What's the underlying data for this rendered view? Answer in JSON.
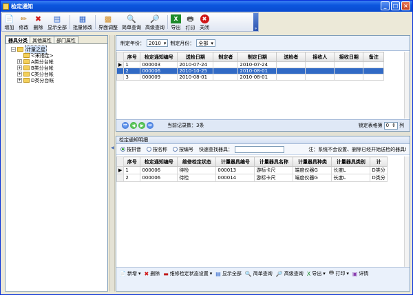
{
  "window": {
    "title": "检定通知"
  },
  "toolbar": [
    {
      "id": "add",
      "label": "增加",
      "icon": "📄"
    },
    {
      "id": "edit",
      "label": "修改",
      "icon": "✏"
    },
    {
      "id": "delete",
      "label": "删除",
      "icon": "✖"
    },
    {
      "id": "showall",
      "label": "显示全部",
      "icon": "▤"
    },
    {
      "id": "batchedit",
      "label": "批量修改",
      "icon": "▦"
    },
    {
      "id": "layout",
      "label": "界面调整",
      "icon": "▩"
    },
    {
      "id": "simplequery",
      "label": "简单查询",
      "icon": "🔍"
    },
    {
      "id": "advquery",
      "label": "高级查询",
      "icon": "🔎"
    },
    {
      "id": "export",
      "label": "导出",
      "icon": "X"
    },
    {
      "id": "print",
      "label": "打印",
      "icon": "🖶"
    },
    {
      "id": "close",
      "label": "关闭",
      "icon": "✖"
    }
  ],
  "left": {
    "tabs": [
      "器具分类",
      "其他属性",
      "部门属性"
    ],
    "tree": {
      "root": "计量之星",
      "children": [
        "<未指定>",
        "A类分台帐",
        "B类分台帐",
        "C类分台帐",
        "D类分台帐"
      ]
    }
  },
  "filter": {
    "year_label": "制定年份：",
    "year": "2010",
    "month_label": "制定月份：",
    "month": "全部"
  },
  "upper_table": {
    "columns": [
      "序号",
      "检定通知编号",
      "送检日期",
      "制定者",
      "制定日期",
      "送检者",
      "接收人",
      "接收日期",
      "备注"
    ],
    "rows": [
      [
        "1",
        "000003",
        "2010-07-24",
        "",
        "2010-07-24",
        "",
        "",
        "",
        ""
      ],
      [
        "2",
        "000006",
        "2010-10-25",
        "",
        "2010-08-01",
        "",
        "",
        "",
        ""
      ],
      [
        "3",
        "000009",
        "2010-08-01",
        "",
        "2010-08-01",
        "",
        "",
        "",
        ""
      ]
    ],
    "selected_index": 1
  },
  "nav": {
    "record_count": "当前记录数：3条",
    "lock_label": "锁定表格第",
    "lock_value": "0",
    "lock_suffix": "列"
  },
  "lower": {
    "title": "检定通知明细",
    "search": {
      "options": [
        "按拼音",
        "按名称",
        "按编号"
      ],
      "selected": 0,
      "quick_label": "快速查找器具：",
      "note": "注：系统不会设置、删除已经开始送检的器具!"
    },
    "table": {
      "columns": [
        "序号",
        "检定通知编号",
        "维修检定状态",
        "计量器具编号",
        "计量器具名称",
        "计量器具种类",
        "计量器具类别",
        "计"
      ],
      "rows": [
        [
          "1",
          "000006",
          "待检",
          "000013",
          "游标卡尺",
          "端度仪器G",
          "长度L",
          "D类分"
        ],
        [
          "2",
          "000006",
          "待检",
          "000014",
          "游标卡尺",
          "端度仪器G",
          "长度L",
          "D类分"
        ]
      ]
    },
    "actions": [
      {
        "label": "新增",
        "icon": "📄",
        "caret": true
      },
      {
        "label": "删除",
        "icon": "✖"
      },
      {
        "label": "维修检定状态设置",
        "icon": "▬",
        "caret": true
      },
      {
        "label": "显示全部",
        "icon": "▤"
      },
      {
        "label": "简单查询",
        "icon": "🔍"
      },
      {
        "label": "高级查询",
        "icon": "🔎"
      },
      {
        "label": "导出",
        "icon": "X",
        "caret": true
      },
      {
        "label": "打印",
        "icon": "🖶",
        "caret": true
      },
      {
        "label": "详情",
        "icon": "▣"
      }
    ]
  }
}
